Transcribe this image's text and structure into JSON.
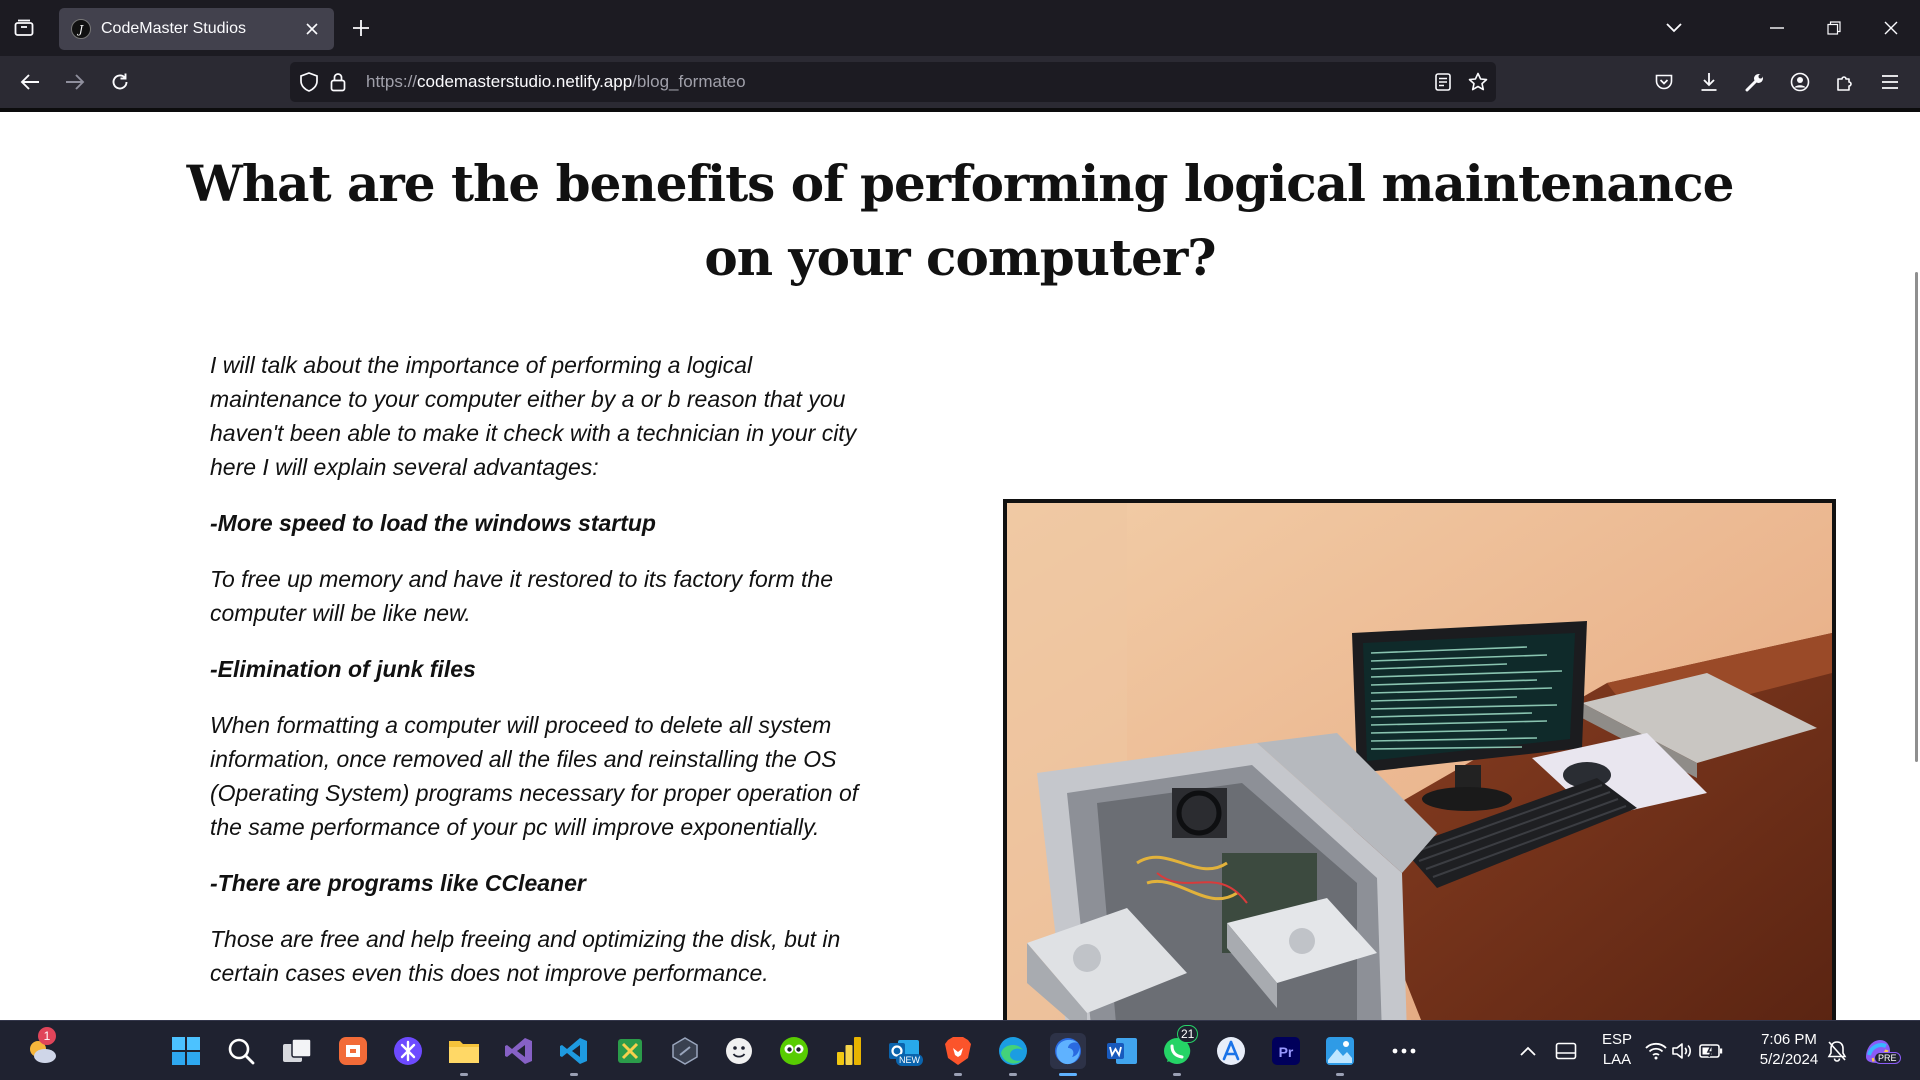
{
  "browser": {
    "tab": {
      "title": "CodeMaster Studios",
      "favicon_letter": "J"
    },
    "url": {
      "scheme": "https://",
      "host": "codemasterstudio.netlify.app",
      "path": "/blog_formateo"
    }
  },
  "article": {
    "title": "What are the benefits of performing logical maintenance on your computer?",
    "paragraphs": [
      {
        "text": "I will talk about the importance of performing a logical maintenance to your computer either by a or b reason that you haven't been able to make it check with a technician in your city here I will explain several advantages:"
      },
      {
        "text": "-More speed to load the windows startup"
      },
      {
        "text": "To free up memory and have it restored to its factory form the computer will be like new."
      },
      {
        "text": "-Elimination of junk files"
      },
      {
        "text": "When formatting a computer will proceed to delete all system information, once removed all the files and reinstalling the OS (Operating System) programs necessary for proper operation of the same performance of your pc will improve exponentially."
      },
      {
        "text": "-There are programs like CCleaner"
      },
      {
        "text": "Those are free and help freeing and optimizing the disk, but in certain cases even this does not improve performance."
      }
    ]
  },
  "taskbar": {
    "weather_badge": "1",
    "whatsapp_badge": "21",
    "outlook_tag": "NEW",
    "copilot_tag": "PRE",
    "language": {
      "line1": "ESP",
      "line2": "LAA"
    },
    "clock": {
      "time": "7:06 PM",
      "date": "5/2/2024"
    }
  },
  "colors": {
    "tabbar_bg": "#1c1b22",
    "navbar_bg": "#2b2a33",
    "taskbar_bg": "#1f2230",
    "accent": "#5fb2ff"
  }
}
